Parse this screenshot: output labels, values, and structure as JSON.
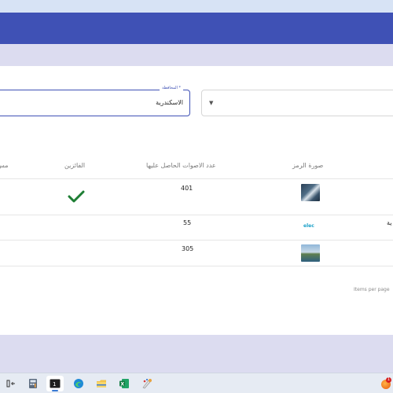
{
  "filters": {
    "governorate_label": "المحافظة *",
    "governorate_value": "الاسكندرية",
    "second_value": ""
  },
  "table": {
    "columns": [
      "صورة الرمز",
      "عدد الاصوات الحاصل عليها",
      "الفائزين",
      "مس"
    ],
    "rows": [
      {
        "votes": "401",
        "winner": true,
        "name": ""
      },
      {
        "votes": "55",
        "winner": false,
        "name": "ية"
      },
      {
        "votes": "305",
        "winner": false,
        "name": ""
      }
    ],
    "row2_logo_text": "elec"
  },
  "paginator": {
    "items_per_page": "Items per page"
  },
  "taskbar": {
    "icons": [
      "split-view-icon",
      "calculator-icon",
      "terminal-icon",
      "edge-icon",
      "file-explorer-icon",
      "excel-icon",
      "paint-icon"
    ],
    "tray_badge": "1"
  },
  "colors": {
    "navbar": "#3f51b5",
    "accent": "#3f51b5",
    "check": "#1e7e34"
  }
}
